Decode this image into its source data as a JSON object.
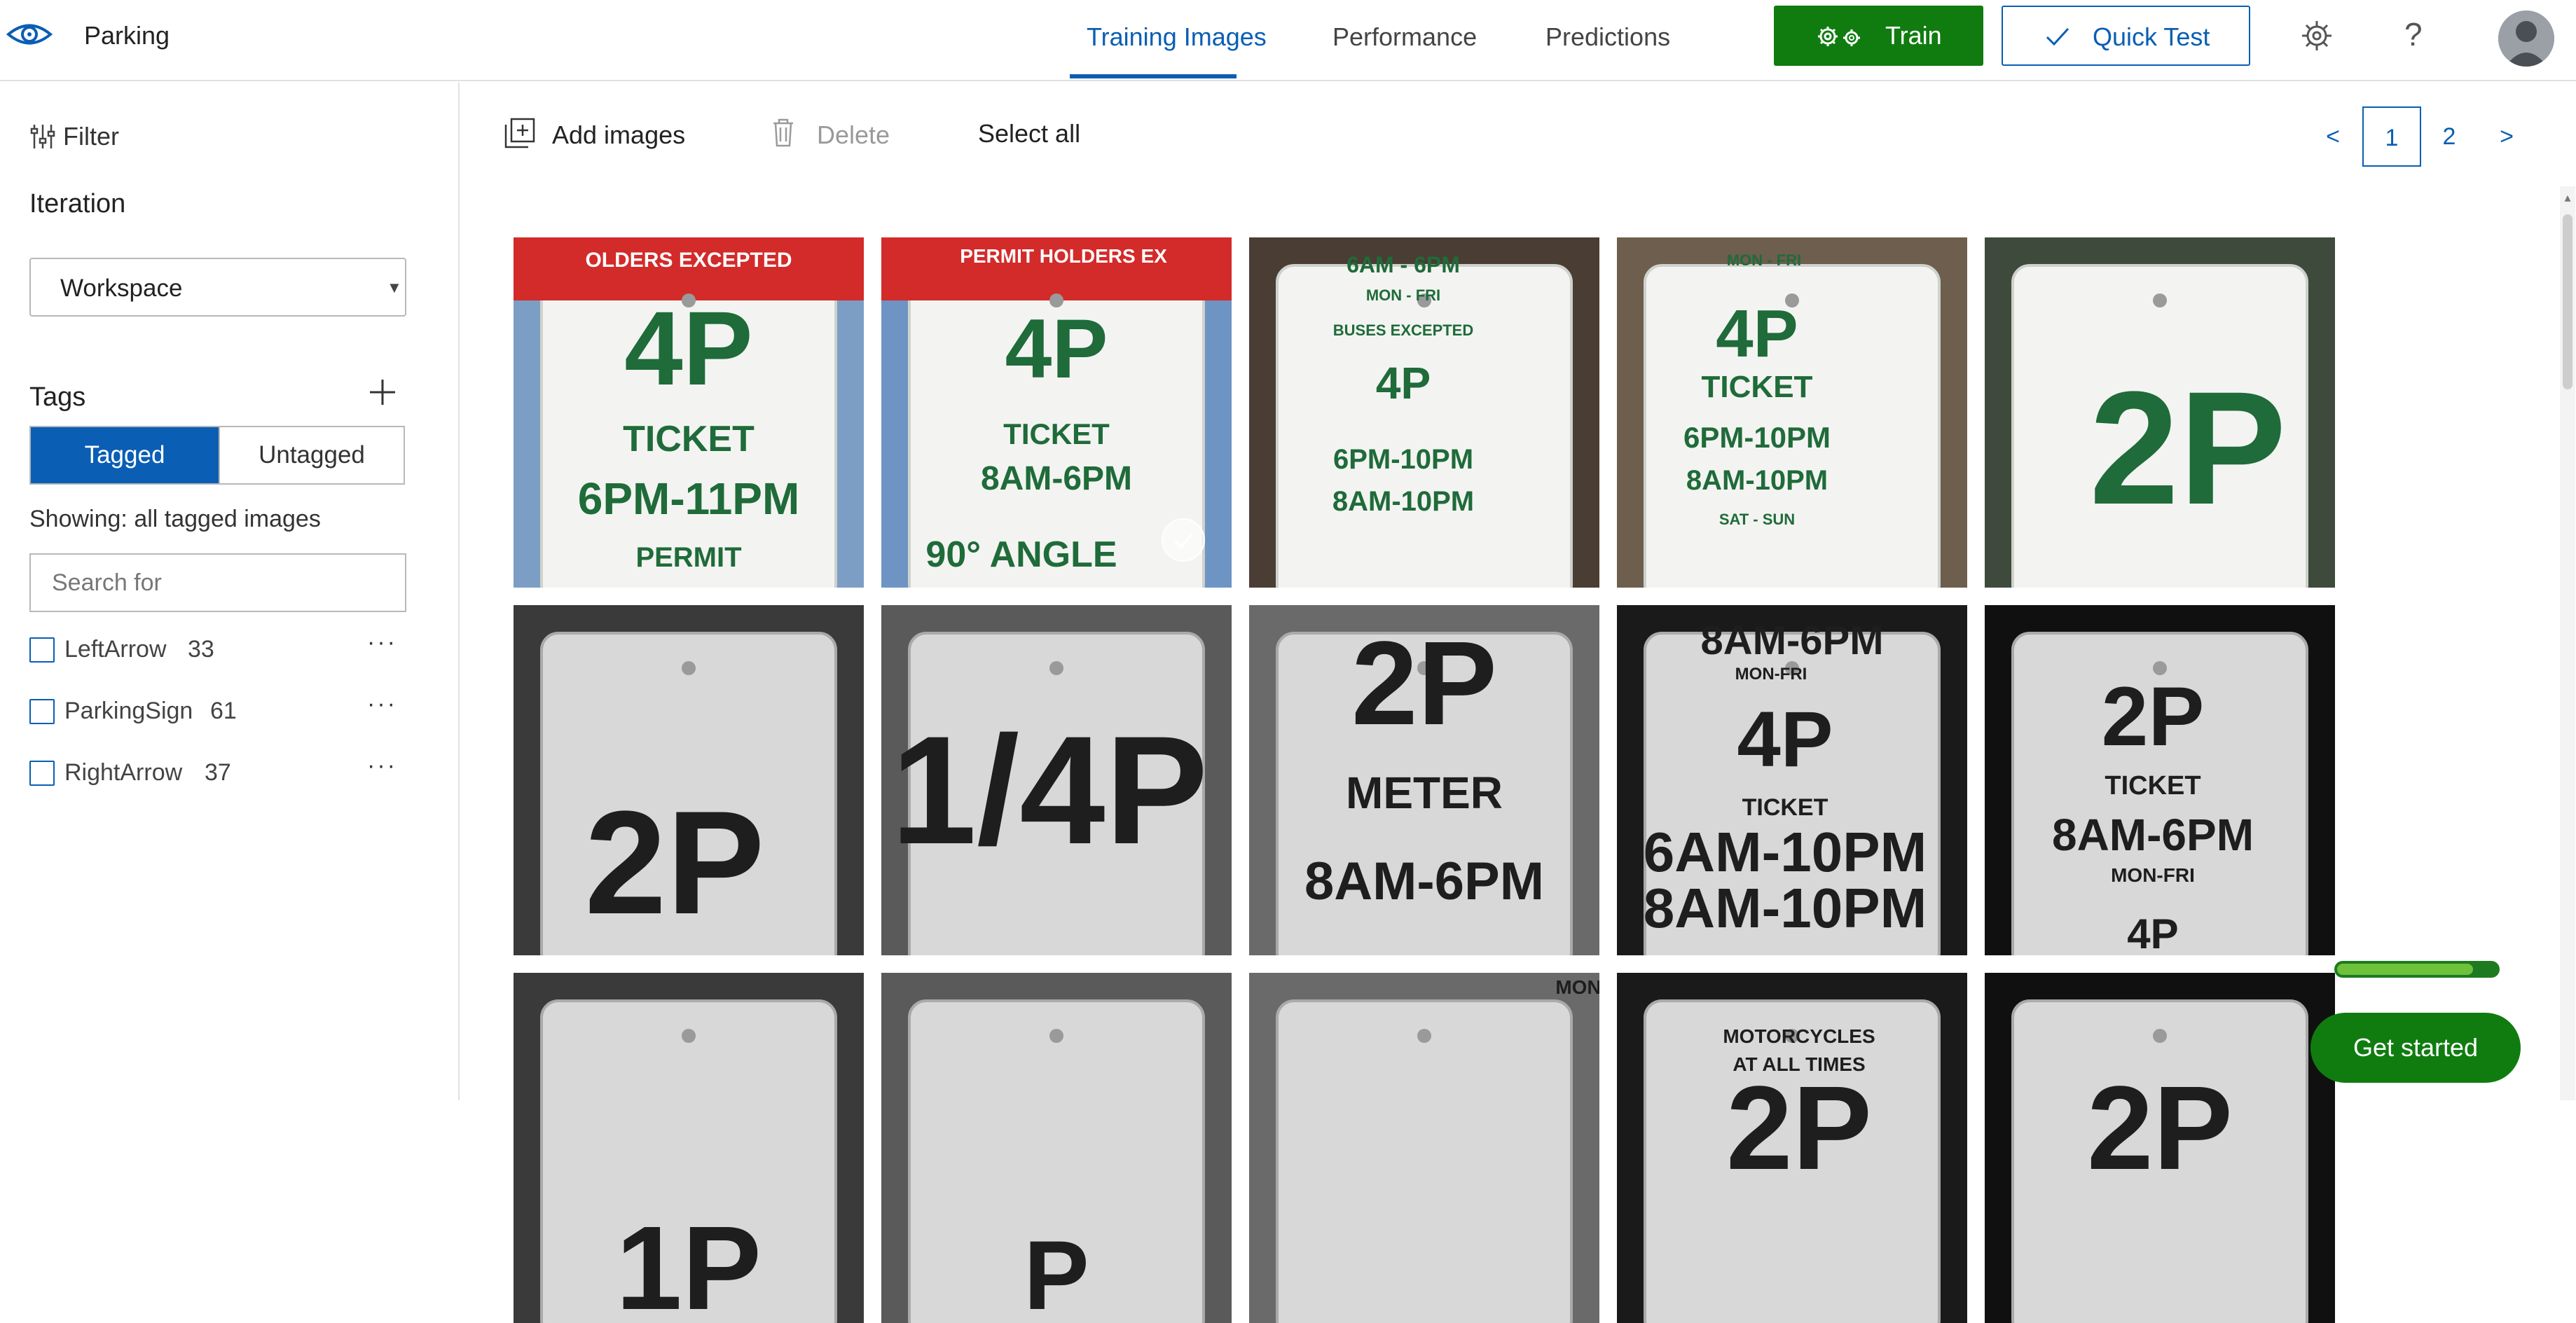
{
  "app": {
    "project_name": "Parking",
    "logo_icon": "eye-icon"
  },
  "nav": {
    "tabs": [
      {
        "label": "Training Images",
        "active": true
      },
      {
        "label": "Performance",
        "active": false
      },
      {
        "label": "Predictions",
        "active": false
      }
    ],
    "train_label": "Train",
    "train_icon": "gears-icon",
    "quick_test_label": "Quick Test",
    "quick_test_icon": "checkmark-icon",
    "settings_icon": "gear-icon",
    "help_icon": "question-icon",
    "help_glyph": "?",
    "avatar_icon": "user-avatar-icon"
  },
  "sidebar": {
    "filter_label": "Filter",
    "iteration_heading": "Iteration",
    "iteration_value": "Workspace",
    "tags_heading": "Tags",
    "toggle": {
      "tagged": "Tagged",
      "untagged": "Untagged",
      "selected": "Tagged"
    },
    "showing_text": "Showing: all tagged images",
    "search_placeholder": "Search for",
    "tags": [
      {
        "name": "LeftArrow",
        "count": "33"
      },
      {
        "name": "ParkingSign",
        "count": "61"
      },
      {
        "name": "RightArrow",
        "count": "37"
      }
    ],
    "more_glyph": "···"
  },
  "toolbar": {
    "add_images_label": "Add images",
    "delete_label": "Delete",
    "select_all_label": "Select all"
  },
  "pager": {
    "prev": "<",
    "pages": [
      "1",
      "2"
    ],
    "current": "1",
    "next": ">"
  },
  "grid": {
    "rows": [
      [
        {
          "texts": [
            "OLDERS EXCEPTED",
            "4P",
            "TICKET",
            "6PM-11PM",
            "PERMIT"
          ],
          "tone": "color"
        },
        {
          "texts": [
            "PERMIT HOLDERS EX",
            "4P",
            "TICKET",
            "8AM-6PM",
            "90° ANGLE"
          ],
          "tone": "color",
          "selected": true
        },
        {
          "texts": [
            "6AM - 6PM",
            "MON - FRI",
            "BUSES EXCEPTED",
            "4P",
            "6PM-10PM",
            "8AM-10PM"
          ],
          "tone": "color"
        },
        {
          "texts": [
            "MON - FRI",
            "4P",
            "TICKET",
            "6PM-10PM",
            "8AM-10PM",
            "SAT - SUN"
          ],
          "tone": "color"
        },
        {
          "texts": [
            "2P"
          ],
          "tone": "color"
        }
      ],
      [
        {
          "texts": [
            "2P"
          ],
          "tone": "gray"
        },
        {
          "texts": [
            "1/4P"
          ],
          "tone": "gray"
        },
        {
          "texts": [
            "2P",
            "METER",
            "8AM-6PM"
          ],
          "tone": "gray"
        },
        {
          "texts": [
            "8AM-6PM",
            "MON-FRI",
            "4P",
            "TICKET",
            "6AM-10PM",
            "8AM-10PM"
          ],
          "tone": "gray"
        },
        {
          "texts": [
            "2P",
            "TICKET",
            "8AM-6PM",
            "MON-FRI",
            "4P"
          ],
          "tone": "gray"
        }
      ],
      [
        {
          "texts": [
            "1P"
          ],
          "tone": "gray"
        },
        {
          "texts": [
            "P"
          ],
          "tone": "gray"
        },
        {
          "texts": [
            "MON"
          ],
          "tone": "gray"
        },
        {
          "texts": [
            "MOTORCYCLES",
            "AT ALL TIMES",
            "2P"
          ],
          "tone": "gray"
        },
        {
          "texts": [
            "2P"
          ],
          "tone": "gray"
        }
      ]
    ],
    "selected_icon": "checkmark-circle-icon"
  },
  "onboarding": {
    "progress": 0.85,
    "get_started_label": "Get started"
  }
}
